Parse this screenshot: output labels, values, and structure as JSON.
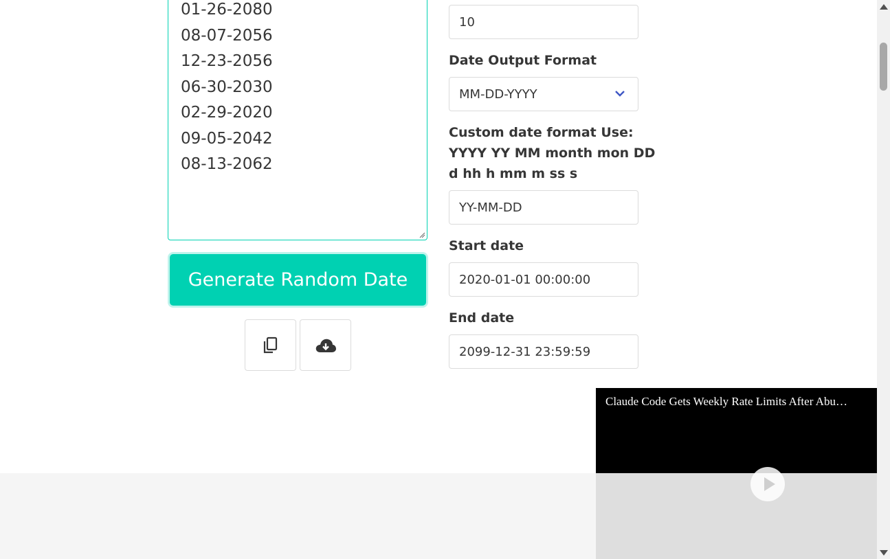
{
  "results": {
    "lines": [
      "01-26-2080",
      "08-07-2056",
      "12-23-2056",
      "06-30-2030",
      "02-29-2020",
      "09-05-2042",
      "08-13-2062"
    ]
  },
  "actions": {
    "generate_label": "Generate Random Date",
    "copy_icon": "copy-icon",
    "download_icon": "cloud-download-icon"
  },
  "settings": {
    "count_value": "10",
    "output_format_label": "Date Output Format",
    "output_format_value": "MM-DD-YYYY",
    "custom_format_label_1": "Custom date format Use:",
    "custom_format_label_2": "YYYY YY MM month mon DD",
    "custom_format_label_3": "d hh h mm m ss s",
    "custom_format_value": "YY-MM-DD",
    "start_label": "Start date",
    "start_value": "2020-01-01 00:00:00",
    "end_label": "End date",
    "end_value": "2099-12-31 23:59:59"
  },
  "video": {
    "title": "Claude Code Gets Weekly Rate Limits After Abu…"
  },
  "colors": {
    "accent": "#00d1b2",
    "select_arrow": "#3e56c4"
  }
}
